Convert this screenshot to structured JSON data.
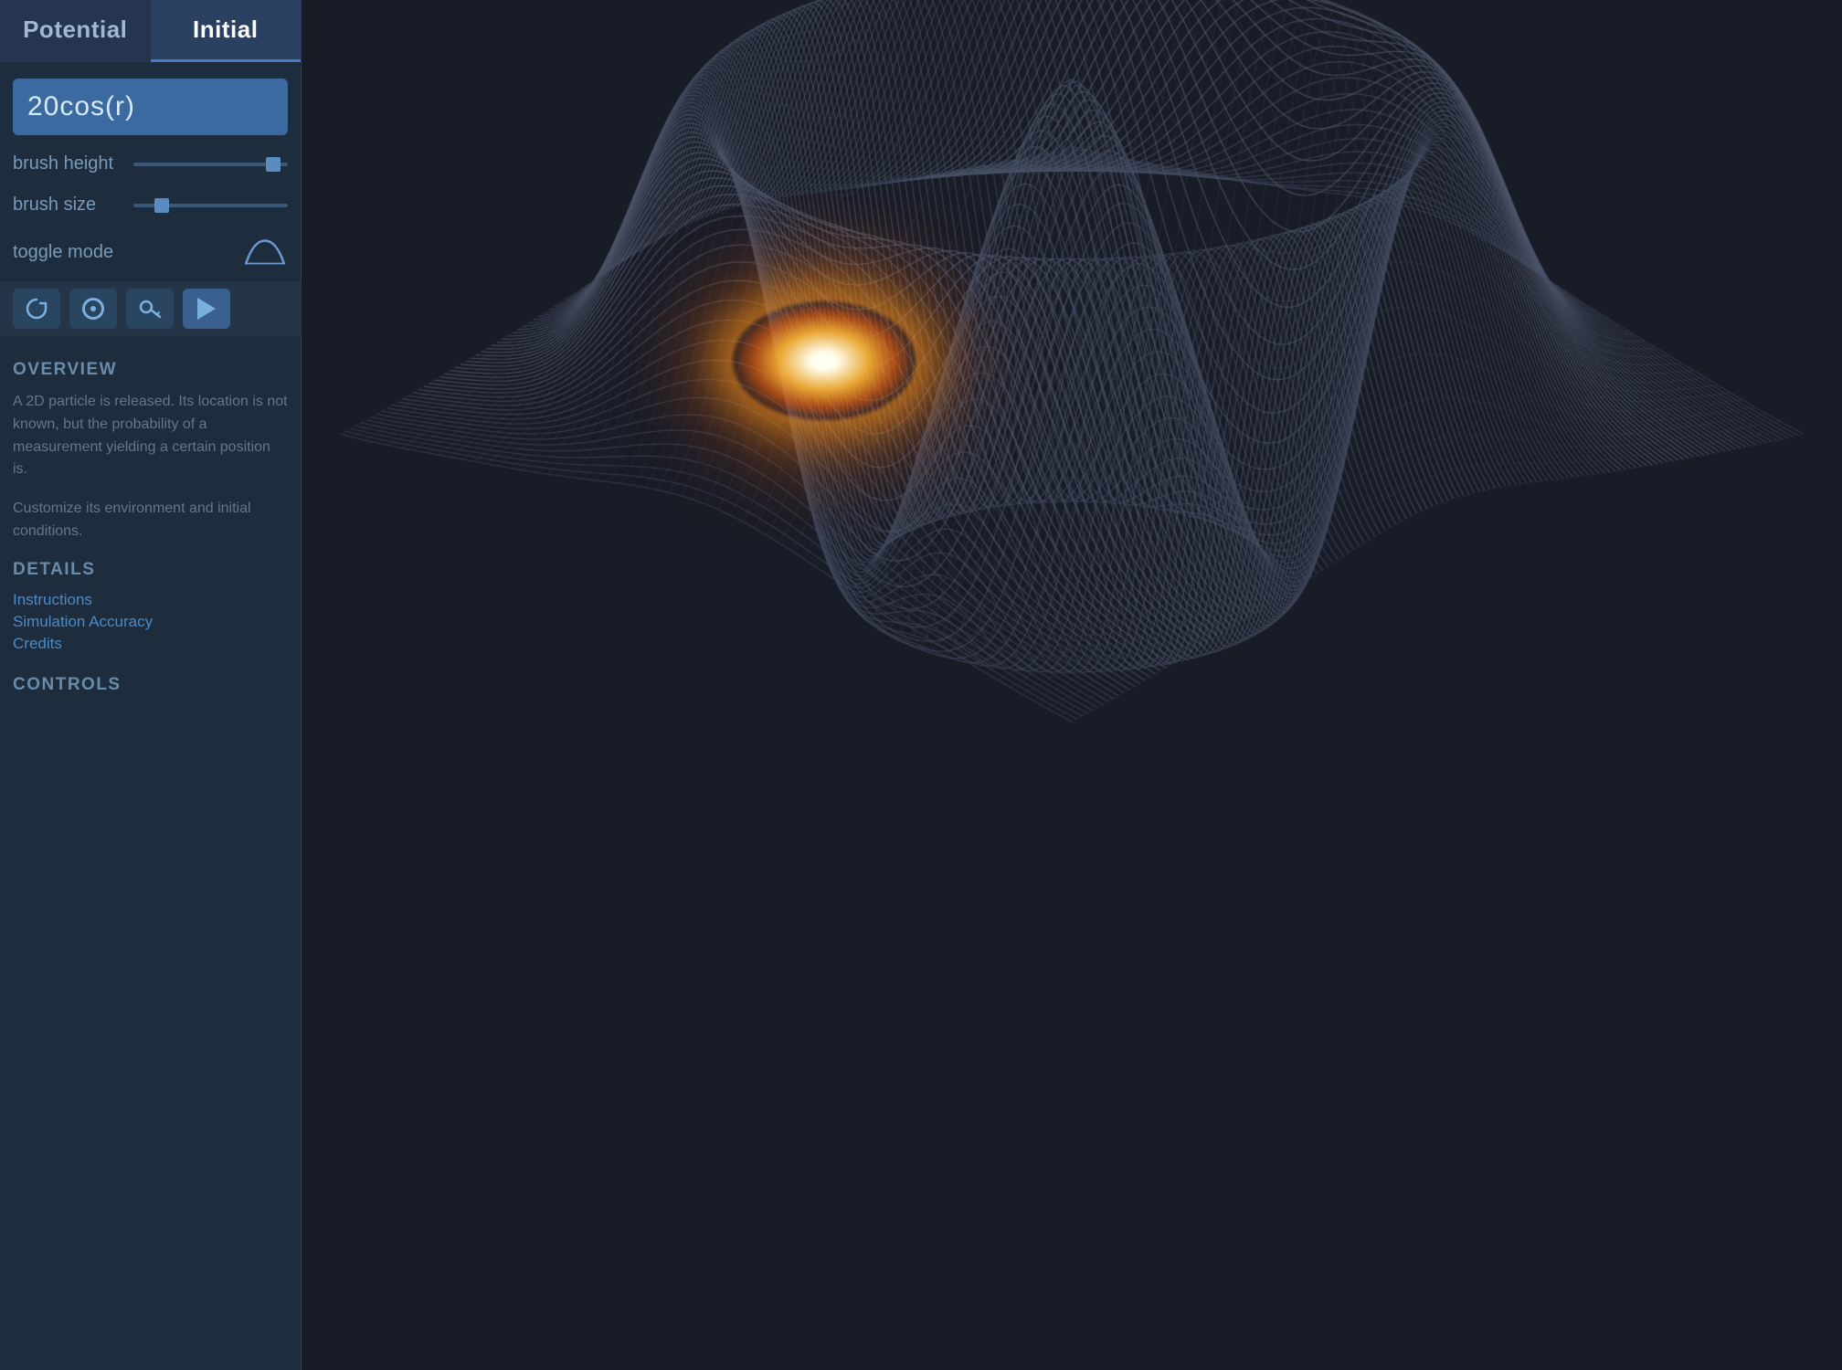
{
  "tabs": [
    {
      "id": "potential",
      "label": "Potential",
      "active": false
    },
    {
      "id": "initial",
      "label": "Initial",
      "active": true
    }
  ],
  "formula": {
    "value": "20cos(r)"
  },
  "controls": {
    "brush_height": {
      "label": "brush height",
      "value": 95,
      "min": 0,
      "max": 100
    },
    "brush_size": {
      "label": "brush size",
      "value": 15,
      "min": 0,
      "max": 100
    },
    "toggle_mode": {
      "label": "toggle mode"
    }
  },
  "action_buttons": [
    {
      "id": "circle-btn",
      "icon": "circle",
      "active": false
    },
    {
      "id": "dot-btn",
      "icon": "dot",
      "active": false
    },
    {
      "id": "key-btn",
      "icon": "key",
      "active": false
    },
    {
      "id": "play-btn",
      "icon": "play",
      "active": true
    }
  ],
  "overview": {
    "header": "OVERVIEW",
    "text1": "A 2D particle is released.  Its location is not known, but the probability of a measurement yielding a certain position is.",
    "text2": "Customize its environment and initial conditions."
  },
  "details": {
    "header": "DETAILS",
    "links": [
      {
        "label": "Instructions"
      },
      {
        "label": "Simulation Accuracy"
      },
      {
        "label": "Credits"
      }
    ]
  },
  "controls_section": {
    "header": "CONTROLS"
  },
  "icons": {
    "play": "▶",
    "key": "🔑",
    "circle_empty": "○",
    "mountain": "⛰"
  }
}
